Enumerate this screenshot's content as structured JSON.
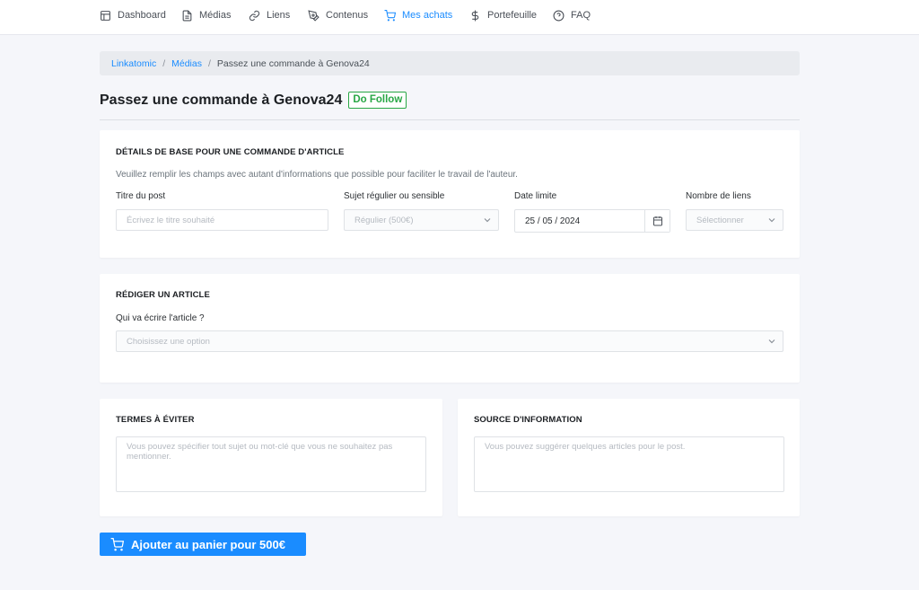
{
  "nav": {
    "items": [
      {
        "label": "Dashboard",
        "icon": "layout-icon"
      },
      {
        "label": "Médias",
        "icon": "document-icon"
      },
      {
        "label": "Liens",
        "icon": "link-icon"
      },
      {
        "label": "Contenus",
        "icon": "pen-tool-icon"
      },
      {
        "label": "Mes achats",
        "icon": "cart-icon",
        "active": true
      },
      {
        "label": "Portefeuille",
        "icon": "dollar-icon"
      },
      {
        "label": "FAQ",
        "icon": "help-circle-icon"
      }
    ]
  },
  "breadcrumb": {
    "home": "Linkatomic",
    "section": "Médias",
    "current": "Passez une commande à Genova24",
    "separator": "/"
  },
  "page": {
    "title": "Passez une commande à Genova24",
    "badge": "Do Follow"
  },
  "basic_details": {
    "title": "DÉTAILS DE BASE POUR UNE COMMANDE D'ARTICLE",
    "description": "Veuillez remplir les champs avec autant d'informations que possible pour faciliter le travail de l'auteur.",
    "post_title_label": "Titre du post",
    "post_title_placeholder": "Écrivez le titre souhaité",
    "subject_label": "Sujet régulier ou sensible",
    "subject_value": "Régulier (500€)",
    "deadline_label": "Date limite",
    "deadline_value": "25 / 05 / 2024",
    "links_label": "Nombre de liens",
    "links_value": "Sélectionner"
  },
  "write_article": {
    "title": "RÉDIGER UN ARTICLE",
    "writer_label": "Qui va écrire l'article ?",
    "writer_value": "Choisissez une option"
  },
  "terms": {
    "title": "TERMES À ÉVITER",
    "placeholder": "Vous pouvez spécifier tout sujet ou mot-clé que vous ne souhaitez pas mentionner."
  },
  "source": {
    "title": "SOURCE D'INFORMATION",
    "placeholder": "Vous pouvez suggérer quelques articles pour le post."
  },
  "cart": {
    "label": "Ajouter au panier pour 500€"
  },
  "colors": {
    "accent": "#1a8cff",
    "badge_green": "#28a745",
    "background": "#f5f6fa"
  }
}
